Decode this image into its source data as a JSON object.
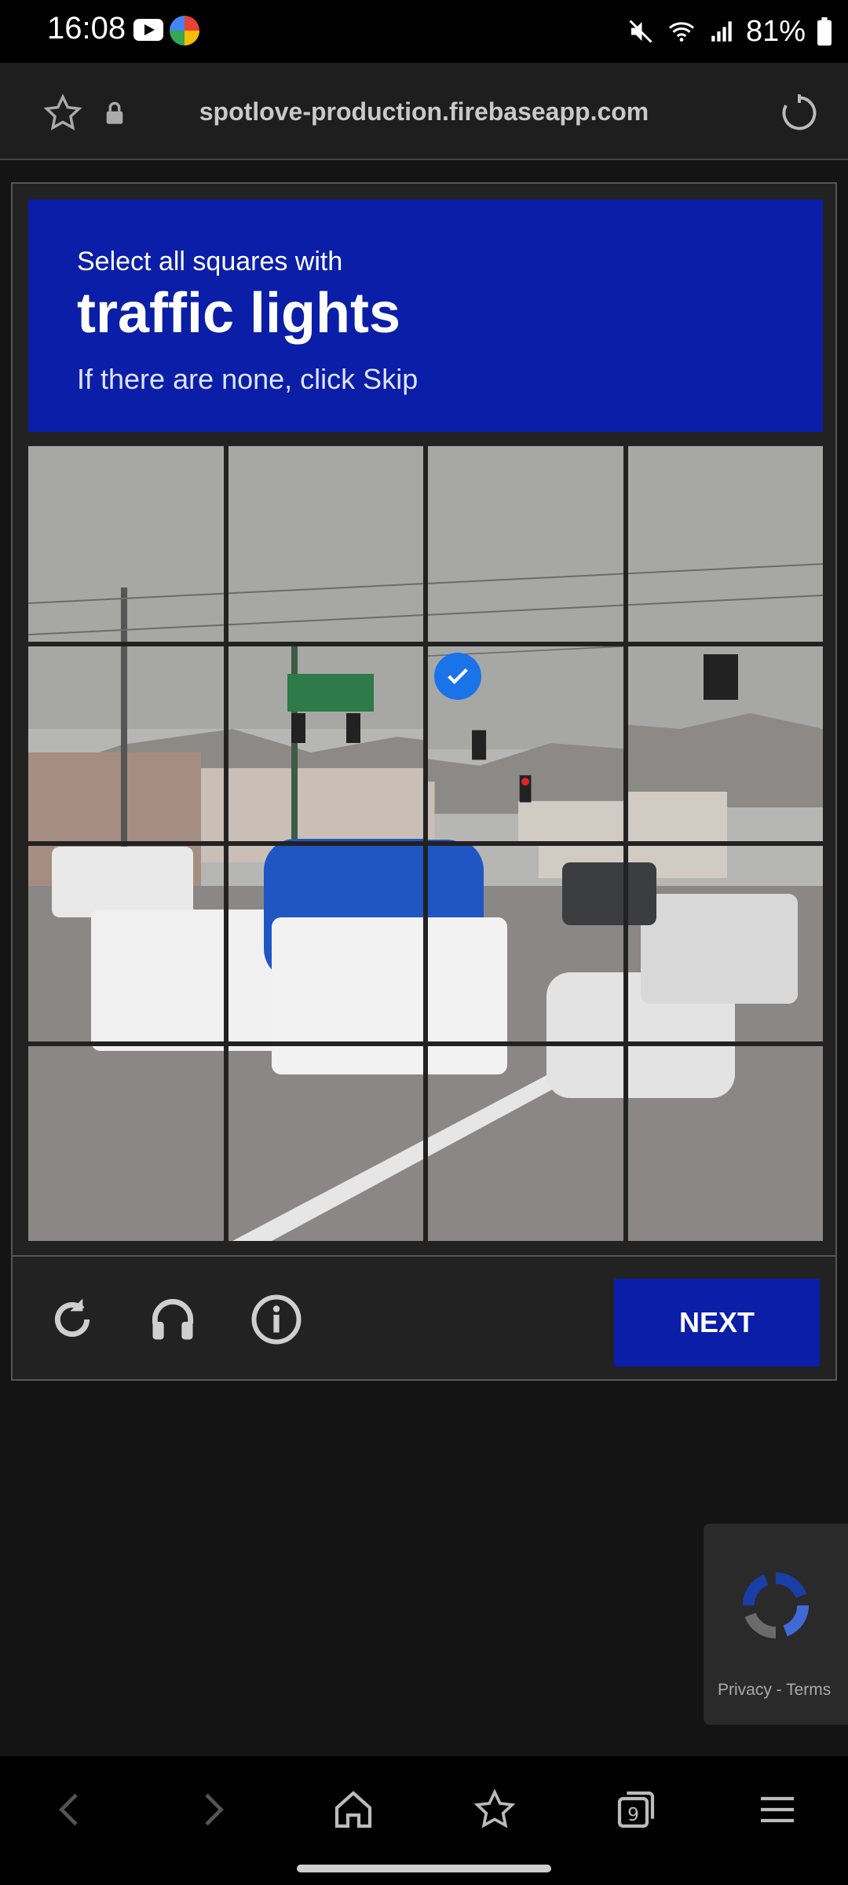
{
  "status_bar": {
    "time": "16:08",
    "battery": "81%"
  },
  "browser": {
    "url": "spotlove-production.firebaseapp.com"
  },
  "captcha": {
    "prompt_small": "Select all squares with",
    "prompt_target": "traffic lights",
    "prompt_hint": "If there are none, click Skip",
    "tiles": [
      {
        "row": 1,
        "col": 1,
        "selected": false
      },
      {
        "row": 1,
        "col": 2,
        "selected": false
      },
      {
        "row": 1,
        "col": 3,
        "selected": false
      },
      {
        "row": 1,
        "col": 4,
        "selected": false
      },
      {
        "row": 2,
        "col": 1,
        "selected": false
      },
      {
        "row": 2,
        "col": 2,
        "selected": false
      },
      {
        "row": 2,
        "col": 3,
        "selected": true
      },
      {
        "row": 2,
        "col": 4,
        "selected": false
      },
      {
        "row": 3,
        "col": 1,
        "selected": false
      },
      {
        "row": 3,
        "col": 2,
        "selected": false
      },
      {
        "row": 3,
        "col": 3,
        "selected": false
      },
      {
        "row": 3,
        "col": 4,
        "selected": false
      },
      {
        "row": 4,
        "col": 1,
        "selected": false
      },
      {
        "row": 4,
        "col": 2,
        "selected": false
      },
      {
        "row": 4,
        "col": 3,
        "selected": false
      },
      {
        "row": 4,
        "col": 4,
        "selected": false
      }
    ],
    "next_label": "NEXT",
    "icons": [
      "reload-icon",
      "audio-icon",
      "info-icon"
    ]
  },
  "recaptcha_badge": {
    "text": "Privacy - Terms"
  },
  "colors": {
    "header_blue": "#0a1ea7",
    "check_blue": "#1a73e8"
  }
}
